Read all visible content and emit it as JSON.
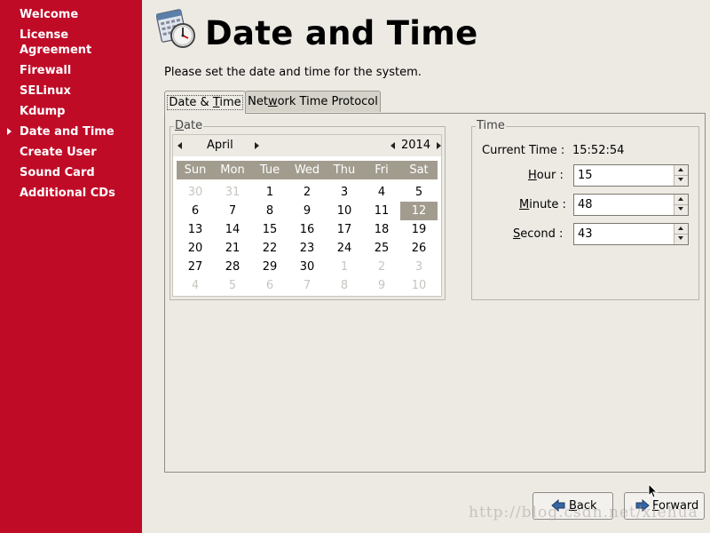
{
  "sidebar": {
    "items": [
      {
        "label": "Welcome"
      },
      {
        "label": "License"
      },
      {
        "label": "Agreement"
      },
      {
        "label": "Firewall"
      },
      {
        "label": "SELinux"
      },
      {
        "label": "Kdump"
      },
      {
        "label": "Date and Time"
      },
      {
        "label": "Create User"
      },
      {
        "label": "Sound Card"
      },
      {
        "label": "Additional CDs"
      }
    ],
    "active_index": 6
  },
  "header": {
    "icon": "calendar-clock-icon",
    "title": "Date and Time",
    "instructions": "Please set the date and time for the system."
  },
  "tabs": [
    {
      "label_pre": "Date & ",
      "label_mnemonic": "T",
      "label_post": "ime",
      "active": true
    },
    {
      "label_pre": "Net",
      "label_mnemonic": "w",
      "label_post": "ork Time Protocol",
      "active": false
    }
  ],
  "date_frame": {
    "label_mnemonic": "D",
    "label_rest": "ate",
    "month": "April",
    "year": "2014",
    "weekdays": [
      "Sun",
      "Mon",
      "Tue",
      "Wed",
      "Thu",
      "Fri",
      "Sat"
    ],
    "weeks": [
      [
        "30",
        "31",
        "1",
        "2",
        "3",
        "4",
        "5"
      ],
      [
        "6",
        "7",
        "8",
        "9",
        "10",
        "11",
        "12"
      ],
      [
        "13",
        "14",
        "15",
        "16",
        "17",
        "18",
        "19"
      ],
      [
        "20",
        "21",
        "22",
        "23",
        "24",
        "25",
        "26"
      ],
      [
        "27",
        "28",
        "29",
        "30",
        "1",
        "2",
        "3"
      ],
      [
        "4",
        "5",
        "6",
        "7",
        "8",
        "9",
        "10"
      ]
    ],
    "selected_day": "12"
  },
  "time_frame": {
    "label": "Time",
    "current_time_label": "Current Time :",
    "current_time_value": "15:52:54",
    "hour_label_mnemonic": "H",
    "hour_label_rest": "our :",
    "hour_value": "15",
    "minute_label_mnemonic": "M",
    "minute_label_rest": "inute :",
    "minute_value": "48",
    "second_label_mnemonic": "S",
    "second_label_rest": "econd :",
    "second_value": "43"
  },
  "buttons": {
    "back_mnemonic": "B",
    "back_rest": "ack",
    "forward_mnemonic": "F",
    "forward_rest": "orward"
  },
  "watermark": "http://blog.csdn.net/xiehua",
  "colors": {
    "sidebar": "#c00b27",
    "background": "#edeae4",
    "calendar_header": "#a29c8f"
  }
}
